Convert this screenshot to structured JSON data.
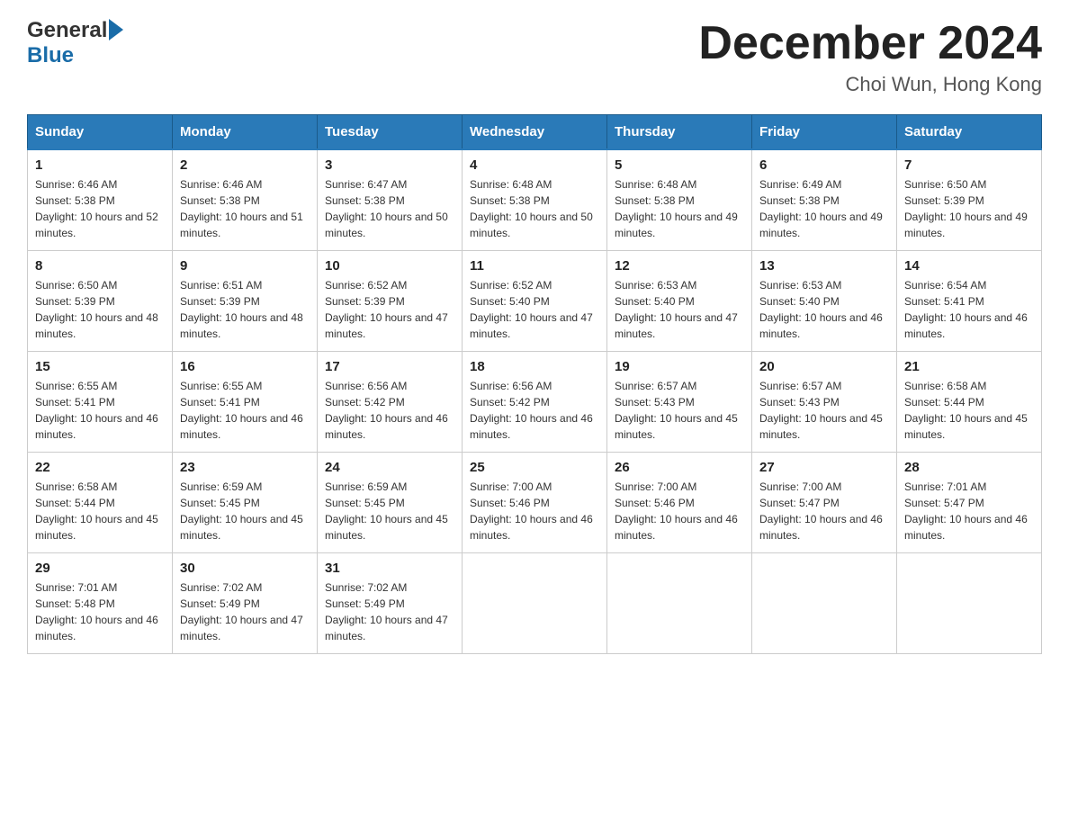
{
  "header": {
    "logo_general": "General",
    "logo_blue": "Blue",
    "month_title": "December 2024",
    "location": "Choi Wun, Hong Kong"
  },
  "days_of_week": [
    "Sunday",
    "Monday",
    "Tuesday",
    "Wednesday",
    "Thursday",
    "Friday",
    "Saturday"
  ],
  "weeks": [
    [
      {
        "num": "1",
        "sunrise": "6:46 AM",
        "sunset": "5:38 PM",
        "daylight": "10 hours and 52 minutes."
      },
      {
        "num": "2",
        "sunrise": "6:46 AM",
        "sunset": "5:38 PM",
        "daylight": "10 hours and 51 minutes."
      },
      {
        "num": "3",
        "sunrise": "6:47 AM",
        "sunset": "5:38 PM",
        "daylight": "10 hours and 50 minutes."
      },
      {
        "num": "4",
        "sunrise": "6:48 AM",
        "sunset": "5:38 PM",
        "daylight": "10 hours and 50 minutes."
      },
      {
        "num": "5",
        "sunrise": "6:48 AM",
        "sunset": "5:38 PM",
        "daylight": "10 hours and 49 minutes."
      },
      {
        "num": "6",
        "sunrise": "6:49 AM",
        "sunset": "5:38 PM",
        "daylight": "10 hours and 49 minutes."
      },
      {
        "num": "7",
        "sunrise": "6:50 AM",
        "sunset": "5:39 PM",
        "daylight": "10 hours and 49 minutes."
      }
    ],
    [
      {
        "num": "8",
        "sunrise": "6:50 AM",
        "sunset": "5:39 PM",
        "daylight": "10 hours and 48 minutes."
      },
      {
        "num": "9",
        "sunrise": "6:51 AM",
        "sunset": "5:39 PM",
        "daylight": "10 hours and 48 minutes."
      },
      {
        "num": "10",
        "sunrise": "6:52 AM",
        "sunset": "5:39 PM",
        "daylight": "10 hours and 47 minutes."
      },
      {
        "num": "11",
        "sunrise": "6:52 AM",
        "sunset": "5:40 PM",
        "daylight": "10 hours and 47 minutes."
      },
      {
        "num": "12",
        "sunrise": "6:53 AM",
        "sunset": "5:40 PM",
        "daylight": "10 hours and 47 minutes."
      },
      {
        "num": "13",
        "sunrise": "6:53 AM",
        "sunset": "5:40 PM",
        "daylight": "10 hours and 46 minutes."
      },
      {
        "num": "14",
        "sunrise": "6:54 AM",
        "sunset": "5:41 PM",
        "daylight": "10 hours and 46 minutes."
      }
    ],
    [
      {
        "num": "15",
        "sunrise": "6:55 AM",
        "sunset": "5:41 PM",
        "daylight": "10 hours and 46 minutes."
      },
      {
        "num": "16",
        "sunrise": "6:55 AM",
        "sunset": "5:41 PM",
        "daylight": "10 hours and 46 minutes."
      },
      {
        "num": "17",
        "sunrise": "6:56 AM",
        "sunset": "5:42 PM",
        "daylight": "10 hours and 46 minutes."
      },
      {
        "num": "18",
        "sunrise": "6:56 AM",
        "sunset": "5:42 PM",
        "daylight": "10 hours and 46 minutes."
      },
      {
        "num": "19",
        "sunrise": "6:57 AM",
        "sunset": "5:43 PM",
        "daylight": "10 hours and 45 minutes."
      },
      {
        "num": "20",
        "sunrise": "6:57 AM",
        "sunset": "5:43 PM",
        "daylight": "10 hours and 45 minutes."
      },
      {
        "num": "21",
        "sunrise": "6:58 AM",
        "sunset": "5:44 PM",
        "daylight": "10 hours and 45 minutes."
      }
    ],
    [
      {
        "num": "22",
        "sunrise": "6:58 AM",
        "sunset": "5:44 PM",
        "daylight": "10 hours and 45 minutes."
      },
      {
        "num": "23",
        "sunrise": "6:59 AM",
        "sunset": "5:45 PM",
        "daylight": "10 hours and 45 minutes."
      },
      {
        "num": "24",
        "sunrise": "6:59 AM",
        "sunset": "5:45 PM",
        "daylight": "10 hours and 45 minutes."
      },
      {
        "num": "25",
        "sunrise": "7:00 AM",
        "sunset": "5:46 PM",
        "daylight": "10 hours and 46 minutes."
      },
      {
        "num": "26",
        "sunrise": "7:00 AM",
        "sunset": "5:46 PM",
        "daylight": "10 hours and 46 minutes."
      },
      {
        "num": "27",
        "sunrise": "7:00 AM",
        "sunset": "5:47 PM",
        "daylight": "10 hours and 46 minutes."
      },
      {
        "num": "28",
        "sunrise": "7:01 AM",
        "sunset": "5:47 PM",
        "daylight": "10 hours and 46 minutes."
      }
    ],
    [
      {
        "num": "29",
        "sunrise": "7:01 AM",
        "sunset": "5:48 PM",
        "daylight": "10 hours and 46 minutes."
      },
      {
        "num": "30",
        "sunrise": "7:02 AM",
        "sunset": "5:49 PM",
        "daylight": "10 hours and 47 minutes."
      },
      {
        "num": "31",
        "sunrise": "7:02 AM",
        "sunset": "5:49 PM",
        "daylight": "10 hours and 47 minutes."
      },
      null,
      null,
      null,
      null
    ]
  ]
}
